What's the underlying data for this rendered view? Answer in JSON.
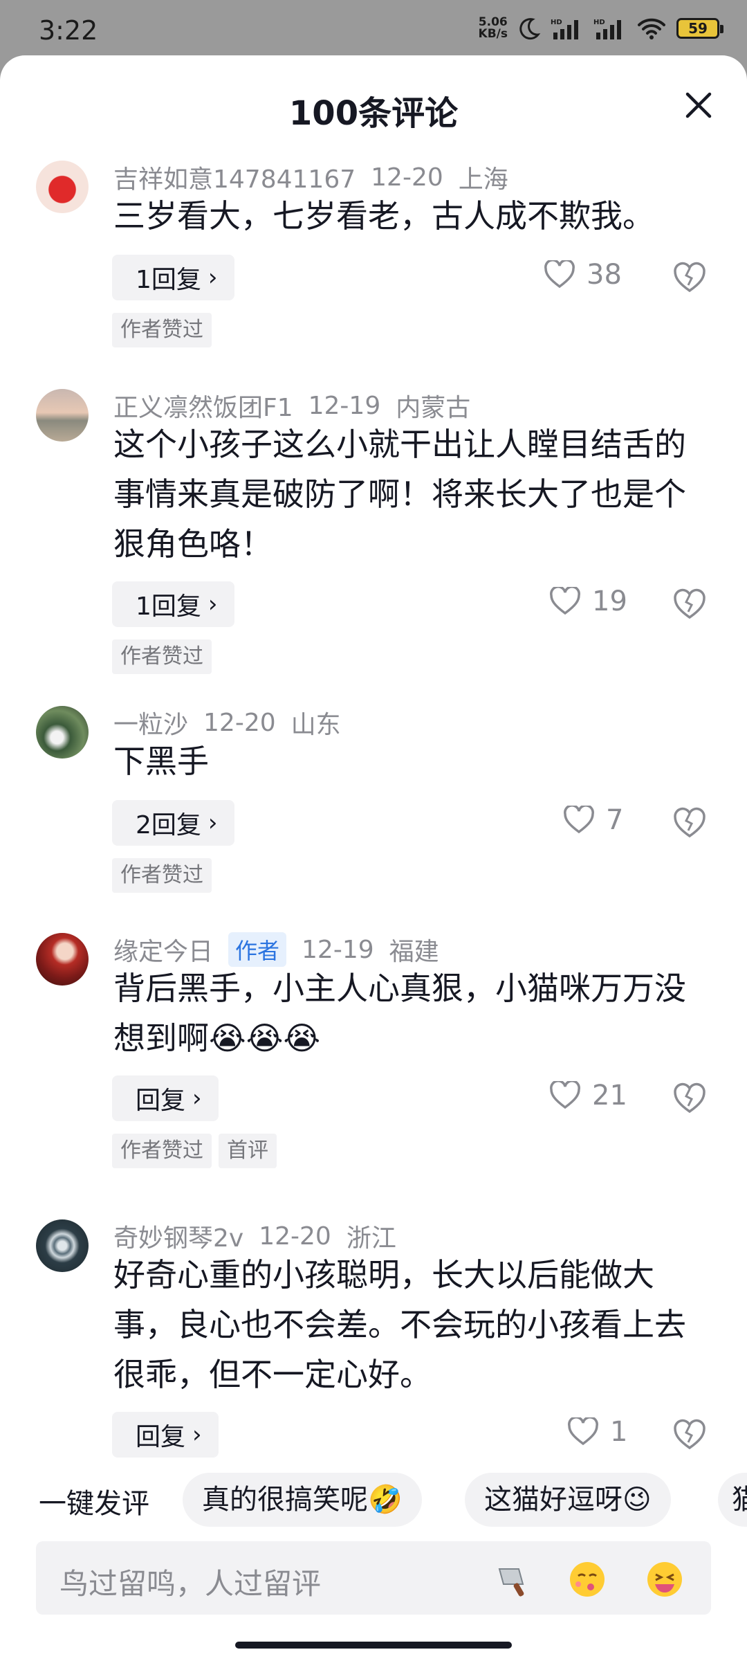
{
  "status": {
    "time": "3:22",
    "net_speed": "5.06",
    "net_unit": "KB/s",
    "battery": "59"
  },
  "header": {
    "title": "100条评论"
  },
  "comments": [
    {
      "user": "吉祥如意147841167",
      "date": "12-20",
      "location": "上海",
      "text": "三岁看大，七岁看老，古人成不欺我。",
      "reply": "1回复",
      "likes": "38",
      "tags": [
        "作者赞过"
      ]
    },
    {
      "user": "正义凛然饭团F1",
      "date": "12-19",
      "location": "内蒙古",
      "text": "这个小孩子这么小就干出让人瞠目结舌的事情来真是破防了啊！将来长大了也是个狠角色咯！",
      "reply": "1回复",
      "likes": "19",
      "tags": [
        "作者赞过"
      ]
    },
    {
      "user": "一粒沙",
      "date": "12-20",
      "location": "山东",
      "text": "下黑手",
      "reply": "2回复",
      "likes": "7",
      "tags": [
        "作者赞过"
      ]
    },
    {
      "user": "缘定今日",
      "badge": "作者",
      "date": "12-19",
      "location": "福建",
      "text": "背后黑手，小主人心真狠，小猫咪万万没想到啊😭😭😭",
      "reply": "回复",
      "likes": "21",
      "tags": [
        "作者赞过",
        "首评"
      ]
    },
    {
      "user": "奇妙钢琴2v",
      "date": "12-20",
      "location": "浙江",
      "text": "好奇心重的小孩聪明，长大以后能做大事，良心也不会差。不会玩的小孩看上去很乖，但不一定心好。",
      "reply": "回复",
      "likes": "1",
      "tags": []
    }
  ],
  "quick_reply": {
    "label": "一键发评",
    "chips": [
      "真的很搞笑呢🤣",
      "这猫好逗呀😉",
      "猫"
    ]
  },
  "input": {
    "placeholder": "鸟过留鸣，人过留评"
  }
}
